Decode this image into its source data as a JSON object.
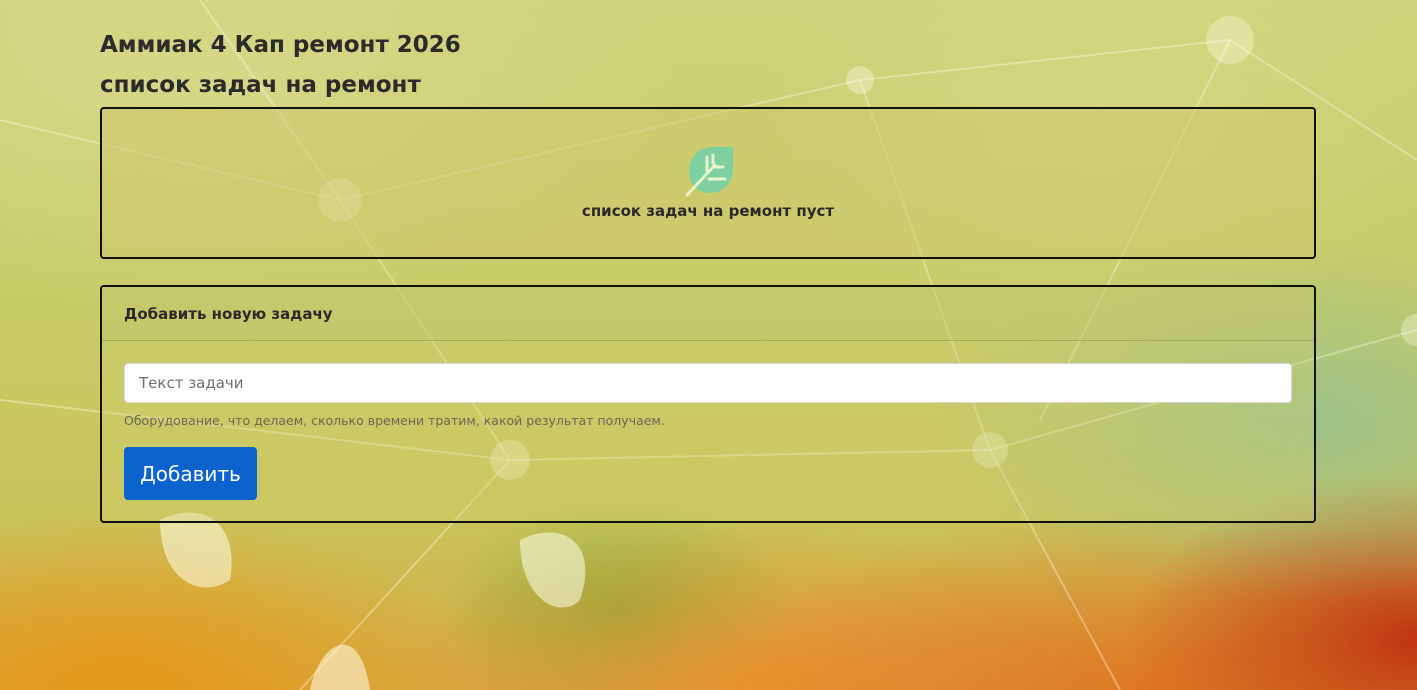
{
  "header": {
    "title": "Аммиак 4 Кап ремонт 2026",
    "subtitle": "список задач на ремонт"
  },
  "task_list": {
    "empty_icon": "leaf-icon",
    "empty_text": "список задач на ремонт пуст"
  },
  "add_form": {
    "header": "Добавить новую задачу",
    "input_placeholder": "Текст задачи",
    "input_value": "",
    "hint": "Оборудование, что делаем, сколько времени тратим, какой результат получаем.",
    "submit_label": "Добавить"
  },
  "colors": {
    "primary_button": "#0b63ce",
    "icon_green": "#7fd0a0",
    "card_border": "#111111"
  }
}
